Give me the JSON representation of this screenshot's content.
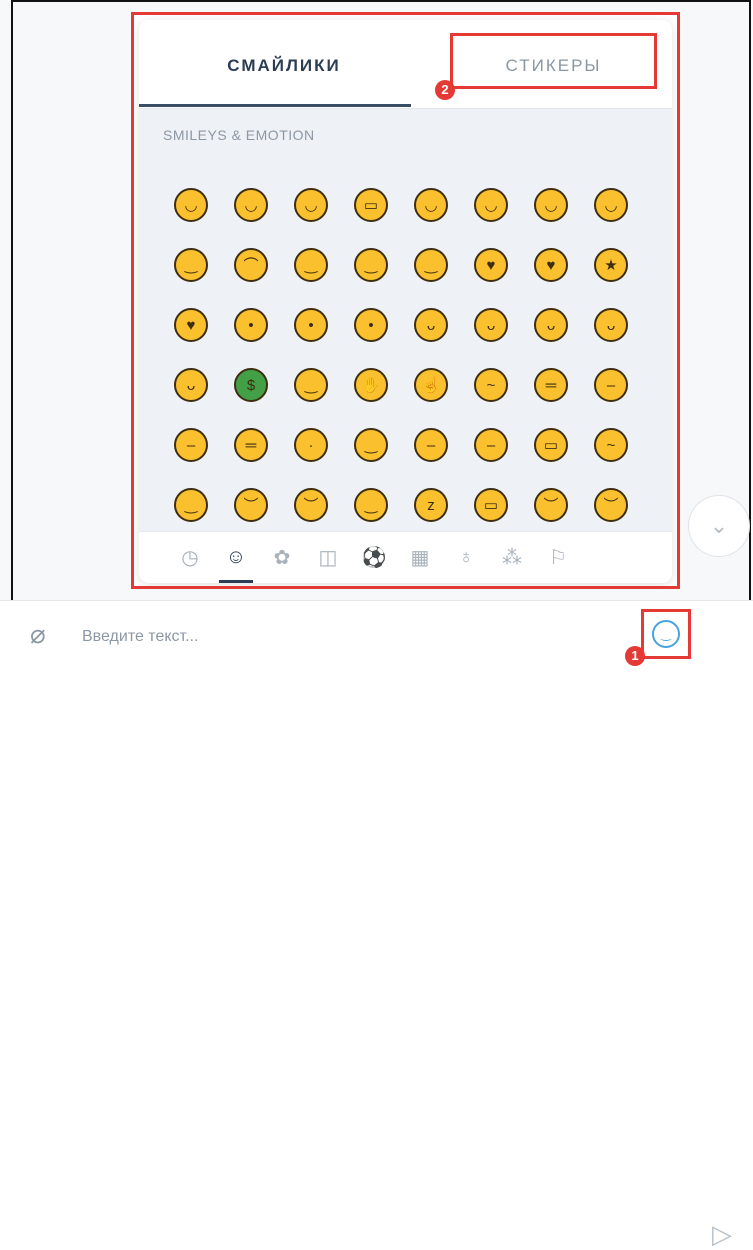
{
  "tabs": {
    "smileys": "СМАЙЛИКИ",
    "stickers": "СТИКЕРЫ"
  },
  "category_title": "SMILEYS & EMOTION",
  "emoji_grid": [
    [
      "😀",
      "😃",
      "😄",
      "😁",
      "😆",
      "😅",
      "🤣",
      "😂"
    ],
    [
      "🙂",
      "🙃",
      "😉",
      "😊",
      "😇",
      "🥰",
      "😍",
      "🤩"
    ],
    [
      "😘",
      "😗",
      "😚",
      "😙",
      "😋",
      "😛",
      "😜",
      "🤪"
    ],
    [
      "😝",
      "🤑",
      "🤗",
      "🤭",
      "🤫",
      "🤔",
      "🤐",
      "🤨"
    ],
    [
      "😐",
      "😑",
      "😶",
      "😏",
      "😒",
      "🙄",
      "😬",
      "🤥"
    ],
    [
      "😌",
      "😔",
      "😪",
      "🤤",
      "😴",
      "😷",
      "🤒",
      "🤕"
    ]
  ],
  "category_icons": [
    "clock-icon",
    "smiley-icon",
    "animal-icon",
    "food-icon",
    "activity-icon",
    "travel-icon",
    "objects-icon",
    "symbols-icon",
    "flags-icon"
  ],
  "input": {
    "placeholder": "Введите текст..."
  },
  "annotations": {
    "badge_1": "1",
    "badge_2": "2"
  },
  "colors": {
    "highlight": "#e53935",
    "accent": "#2c3e55",
    "emoji_button": "#4aa3df"
  }
}
